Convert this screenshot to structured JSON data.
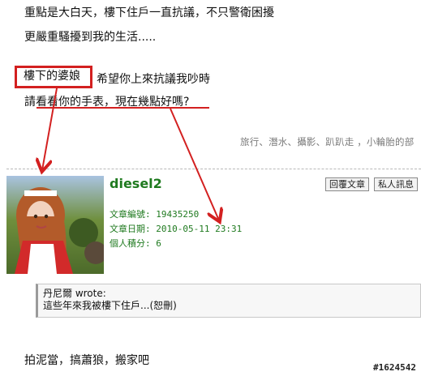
{
  "lines": {
    "line1": "重點是大白天，樓下住戶一直抗議，不只警衛困擾",
    "line2": "更嚴重騷擾到我的生活.....",
    "boxed": "樓下的婆娘",
    "line3_after": "希望你上來抗議我吵時",
    "line4": "請看看你的手表，現在幾點好嗎?",
    "line5": "拍泥當，搞蕭狼，搬家吧"
  },
  "signature": "旅行、潛水、攝影、趴趴走 ，小輪胎的部",
  "post": {
    "username": "diesel2",
    "buttons": {
      "reply": "回覆文章",
      "pm": "私人訊息"
    },
    "meta": {
      "article_id": "文章編號: 19435250",
      "date": "文章日期: 2010-05-11 23:31",
      "points": "個人積分: 6"
    }
  },
  "quote": {
    "author": "丹尼爾 wrote:",
    "text": "這些年來我被樓下住戶...(恕刪)"
  },
  "post_number": "#1624542",
  "colors": {
    "annotation_red": "#d32020",
    "username_green": "#1f7a1f"
  }
}
